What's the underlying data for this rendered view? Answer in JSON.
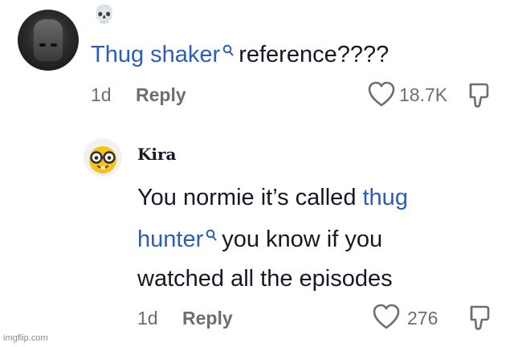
{
  "comments": [
    {
      "username_emoji": "💀",
      "text_link": "Thug shaker",
      "text_rest": "reference????",
      "age": "1d",
      "reply_label": "Reply",
      "likes": "18.7K"
    },
    {
      "username": "Kira",
      "line1_plain": "You normie it’s called ",
      "line1_link": "thug",
      "line2_link": "hunter",
      "line2_plain": "you know if you",
      "line3": "watched all the episodes",
      "age": "1d",
      "reply_label": "Reply",
      "likes": "276"
    }
  ],
  "watermark": "imgflip.com",
  "colors": {
    "link": "#2b5db9",
    "muted": "#6e6e6e",
    "text": "#161823"
  },
  "icons": [
    "skull-emoji",
    "search-icon",
    "heart-icon",
    "dislike-icon",
    "nerd-face-emoji"
  ]
}
